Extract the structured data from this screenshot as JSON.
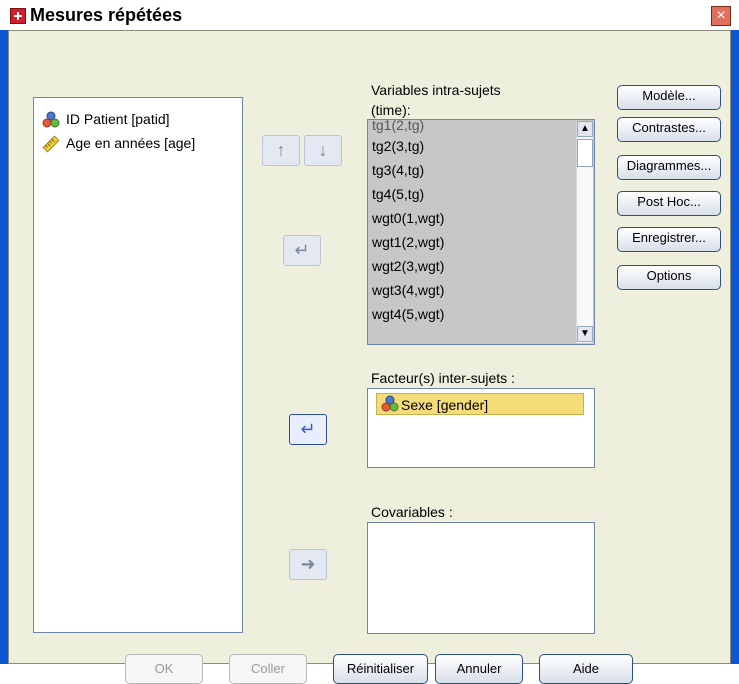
{
  "window": {
    "title": "Mesures répétées",
    "close_symbol": "×"
  },
  "source_list": {
    "items": [
      {
        "label": "ID Patient [patid]",
        "icon": "scale-nominal-icon"
      },
      {
        "label": "Age en années [age]",
        "icon": "scale-ruler-icon"
      }
    ]
  },
  "within_subjects": {
    "label": "Variables intra-sujets",
    "sub_label": "(time):",
    "partial_item": "tg1(2,tg)",
    "items": [
      "tg2(3,tg)",
      "tg3(4,tg)",
      "tg4(5,tg)",
      "wgt0(1,wgt)",
      "wgt1(2,wgt)",
      "wgt2(3,wgt)",
      "wgt3(4,wgt)",
      "wgt4(5,wgt)"
    ]
  },
  "between_subjects": {
    "label": "Facteur(s) inter-sujets :",
    "items": [
      {
        "label": "Sexe [gender]",
        "icon": "scale-nominal-icon"
      }
    ]
  },
  "covariates": {
    "label": "Covariables :"
  },
  "side_buttons": [
    {
      "label": "Modèle...",
      "name": "model-button"
    },
    {
      "label": "Contrastes...",
      "name": "contrasts-button"
    },
    {
      "label": "Diagrammes...",
      "name": "plots-button"
    },
    {
      "label": "Post Hoc...",
      "name": "post-hoc-button"
    },
    {
      "label": "Enregistrer...",
      "name": "save-button"
    },
    {
      "label": "Options",
      "name": "options-button"
    }
  ],
  "move_controls": {
    "up": "↑",
    "down": "↓",
    "move_back": "↵",
    "add_between": "↵",
    "add_cov": "➜"
  },
  "bottom_buttons": [
    {
      "label": "OK",
      "state": "disabled"
    },
    {
      "label": "Coller",
      "state": "disabled"
    },
    {
      "label": "Réinitialiser",
      "state": "enabled"
    },
    {
      "label": "Annuler",
      "state": "enabled"
    },
    {
      "label": "Aide",
      "state": "enabled"
    }
  ],
  "colors": {
    "window_frame": "#0a56d4",
    "selected_item": "#f5dc78",
    "panel_background": "#efefde"
  }
}
